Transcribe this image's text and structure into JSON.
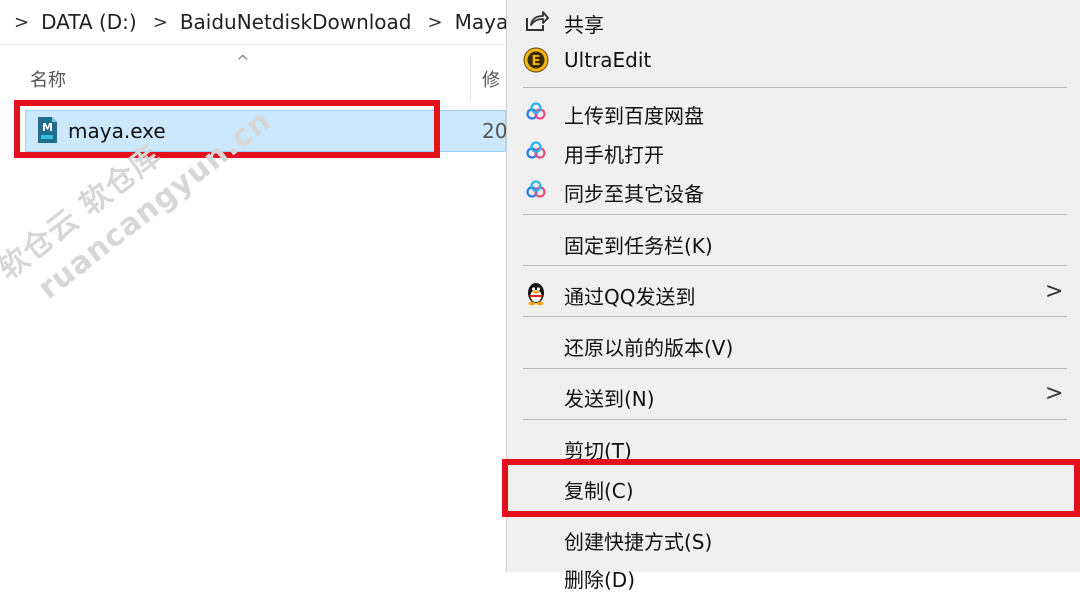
{
  "explorer": {
    "breadcrumb": [
      "DATA (D:)",
      "BaiduNetdiskDownload",
      "Maya"
    ],
    "columns": {
      "name": "名称",
      "modified": "修"
    },
    "sort_arrow": "^",
    "file": {
      "name": "maya.exe",
      "date": "20"
    }
  },
  "watermark": {
    "line1": "软仓云 软仓库",
    "line2": "ruancangyun.cn"
  },
  "menu": {
    "items": [
      {
        "label": "共享",
        "icon": "share-icon"
      },
      {
        "label": "UltraEdit",
        "icon": "ultraedit-icon"
      },
      {
        "label": "上传到百度网盘",
        "icon": "baidu-netdisk-icon"
      },
      {
        "label": "用手机打开",
        "icon": "baidu-netdisk-icon"
      },
      {
        "label": "同步至其它设备",
        "icon": "baidu-netdisk-icon"
      },
      {
        "label": "固定到任务栏(K)",
        "icon": ""
      },
      {
        "label": "通过QQ发送到",
        "icon": "qq-icon",
        "submenu": ">"
      },
      {
        "label": "还原以前的版本(V)",
        "icon": ""
      },
      {
        "label": "发送到(N)",
        "icon": "",
        "submenu": ">"
      },
      {
        "label": "剪切(T)",
        "icon": ""
      },
      {
        "label": "复制(C)",
        "icon": ""
      },
      {
        "label": "创建快捷方式(S)",
        "icon": ""
      },
      {
        "label": "删除(D)",
        "icon": ""
      }
    ]
  },
  "colors": {
    "highlight": "#e3101e",
    "selection": "#cce8ff",
    "menu_bg": "#f0f0f0"
  }
}
